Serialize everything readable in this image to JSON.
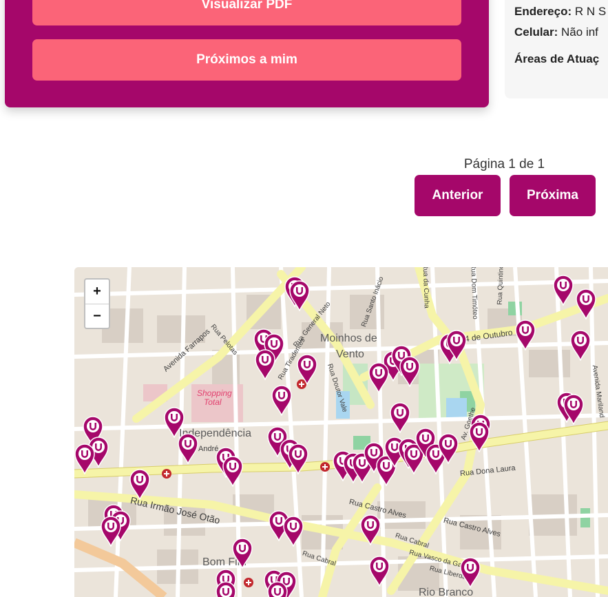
{
  "actions": {
    "view_pdf_label": "Visualizar PDF",
    "nearby_label": "Próximos a mim"
  },
  "card": {
    "address_label": "Endereço:",
    "address_value": "R N S",
    "phone_label": "Celular:",
    "phone_value": "Não inf",
    "areas_label": "Áreas de Atuaç"
  },
  "pagination": {
    "label": "Página 1 de 1",
    "prev_label": "Anterior",
    "next_label": "Próxima"
  },
  "map": {
    "zoom_in_label": "+",
    "zoom_out_label": "−",
    "labels": {
      "moinhos": "Moinhos de",
      "vento": "Vento",
      "independencia": "Independência",
      "bomfim": "Bom Fim",
      "riobranco": "Rio Branco",
      "shopping1": "Shopping",
      "shopping2": "Total",
      "farrapos": "Avenida Farrapos",
      "irmao": "Rua Irmão José Otão",
      "outubro": "24 de Outubro",
      "castroalves": "Rua Castro Alves",
      "castroalves2": "Rua Castro Alves",
      "donalaura": "Rua Dona Laura",
      "vascodagama": "Rua Vasco da Gama",
      "liberdade": "Rua Liberdade",
      "cabral": "Rua Cabral",
      "cabral2": "Rua Cabral",
      "doutorvale": "Rua Doutor Vale",
      "pelotas": "Rua Pelotas",
      "generalneto": "Rua General Neto",
      "tiradentes": "Rua Tiradentes",
      "goethe": "Av. Goethe",
      "timoteo": "Rua Dom Timóteo",
      "quintino": "Rua Quintino",
      "dacunha": "Rua da Cunha",
      "mariland": "Avenida Mariland",
      "andre": "André",
      "santoinacio": "Rua Santo Inácio"
    },
    "marker_color": "#a5076a",
    "road_color": "#f6f4a8",
    "hospital_color": "#c2272d"
  },
  "colors": {
    "brand": "#a5076a",
    "accent": "#fb6478"
  }
}
